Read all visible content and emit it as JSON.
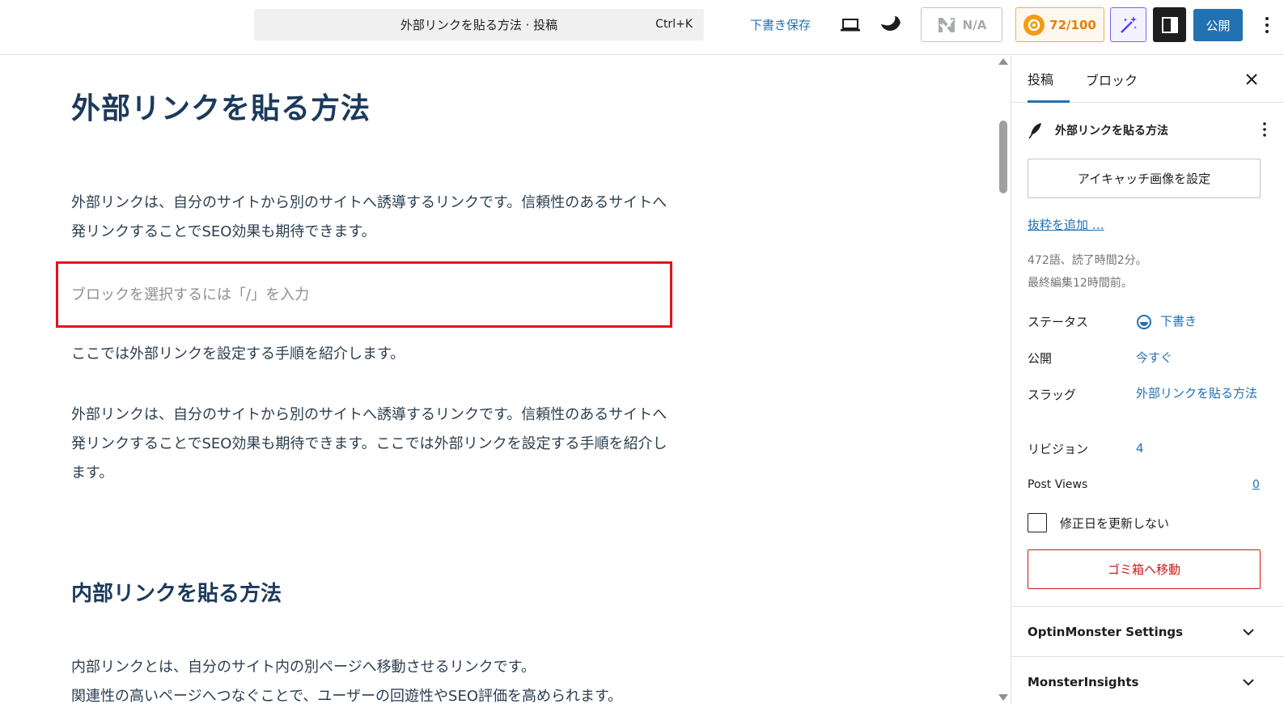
{
  "topbar": {
    "command_title": "外部リンクを貼る方法 · 投稿",
    "command_shortcut": "Ctrl+K",
    "save_draft": "下書き保存",
    "na_label": "N/A",
    "seo_score": "72/100",
    "publish": "公開"
  },
  "editor": {
    "title": "外部リンクを貼る方法",
    "paragraph1": "外部リンクは、自分のサイトから別のサイトへ誘導するリンクです。信頼性のあるサイトへ発リンクすることでSEO効果も期待できます。",
    "placeholder": "ブロックを選択するには「/」を入力",
    "paragraph2": "ここでは外部リンクを設定する手順を紹介します。",
    "paragraph3": "外部リンクは、自分のサイトから別のサイトへ誘導するリンクです。信頼性のあるサイトへ発リンクすることでSEO効果も期待できます。ここでは外部リンクを設定する手順を紹介します。",
    "heading2": "内部リンクを貼る方法",
    "paragraph4_line1": "内部リンクとは、自分のサイト内の別ページへ移動させるリンクです。",
    "paragraph4_line2": "関連性の高いページへつなぐことで、ユーザーの回遊性やSEO評価を高められます。"
  },
  "sidebar": {
    "tab_post": "投稿",
    "tab_block": "ブロック",
    "post_title": "外部リンクを貼る方法",
    "featured_image": "アイキャッチ画像を設定",
    "add_excerpt": "抜粋を追加 …",
    "meta_words": "472語、読了時間2分。",
    "meta_edited": "最終編集12時間前。",
    "status_label": "ステータス",
    "status_value": "下書き",
    "publish_label": "公開",
    "publish_value": "今すぐ",
    "slug_label": "スラッグ",
    "slug_value": "外部リンクを貼る方法",
    "revision_label": "リビジョン",
    "revision_value": "4",
    "views_label": "Post Views",
    "views_value": "0",
    "checkbox_label": "修正日を更新しない",
    "trash": "ゴミ箱へ移動",
    "panel_optinmonster": "OptinMonster Settings",
    "panel_monsterinsights": "MonsterInsights"
  },
  "colors": {
    "accent": "#2271b1",
    "title_navy": "#1b3a5c",
    "highlight_red": "#e0141e",
    "danger": "#cc1818",
    "seo_orange": "#f39c12"
  },
  "icons": [
    "laptop-icon",
    "moon-icon",
    "n-logo-icon",
    "seo-gear-icon",
    "magic-wand-icon",
    "sidebar-toggle-icon",
    "more-vertical-icon",
    "close-icon",
    "feather-icon",
    "draft-status-icon",
    "chevron-down-icon"
  ]
}
